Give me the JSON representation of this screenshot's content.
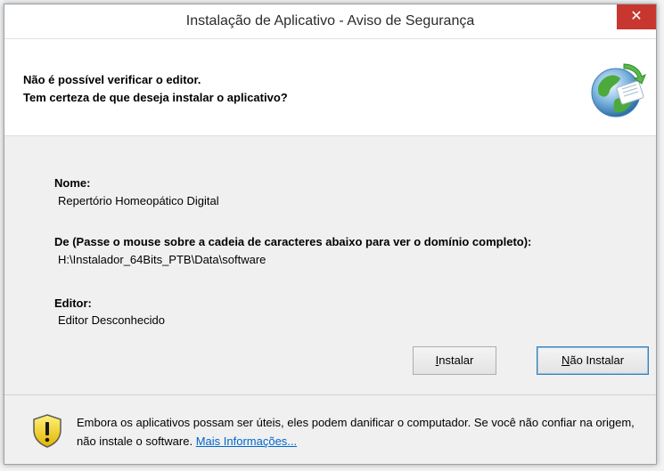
{
  "window": {
    "title": "Instalação de Aplicativo - Aviso de Segurança",
    "close_glyph": "✕"
  },
  "header": {
    "line1": "Não é possível verificar o editor.",
    "line2": "Tem certeza de que deseja instalar o aplicativo?",
    "icon": "globe-install-icon"
  },
  "details": {
    "name_label": "Nome:",
    "name_value": "Repertório Homeopático Digital",
    "from_label": "De (Passe o mouse sobre a cadeia de caracteres abaixo para ver o domínio completo):",
    "from_value": "H:\\Instalador_64Bits_PTB\\Data\\software",
    "publisher_label": "Editor:",
    "publisher_value": "Editor Desconhecido"
  },
  "buttons": {
    "install_mnemonic": "I",
    "install_rest": "nstalar",
    "dont_install_mnemonic": "N",
    "dont_install_rest": "ão Instalar"
  },
  "footer": {
    "warning_text": "Embora os aplicativos possam ser úteis, eles podem danificar o computador. Se você não confiar na origem, não instale o software.",
    "link_text": "Mais Informações...",
    "icon": "warning-shield-icon"
  },
  "colors": {
    "close_button": "#c7372f",
    "link": "#0066cc"
  }
}
